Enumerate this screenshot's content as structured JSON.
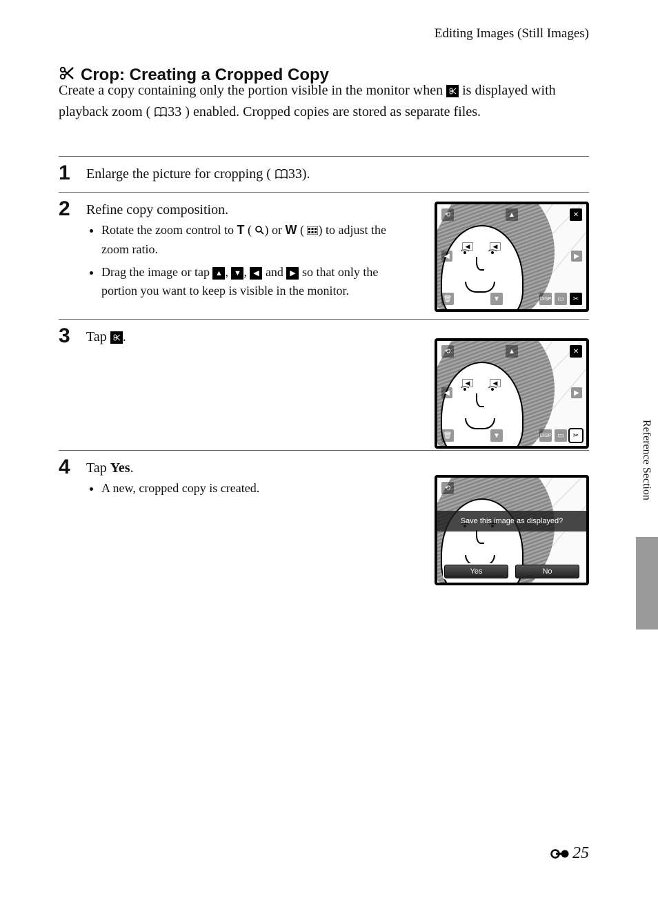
{
  "breadcrumb": "Editing Images (Still Images)",
  "title": "Crop: Creating a Cropped Copy",
  "intro": {
    "part1": "Create a copy containing only the portion visible in the monitor when ",
    "part2": " is displayed with playback zoom (",
    "ref1": "33",
    "part3": ") enabled. Cropped copies are stored as separate files."
  },
  "steps": {
    "s1": {
      "num": "1",
      "line_a": "Enlarge the picture for cropping (",
      "ref": "33",
      "line_b": ")."
    },
    "s2": {
      "num": "2",
      "line": "Refine copy composition.",
      "b1a": "Rotate the zoom control to ",
      "b1_T": "T",
      "b1b": " (",
      "b1c": ") or ",
      "b1_W": "W",
      "b1d": " (",
      "b1e": ") to adjust the zoom ratio.",
      "b2a": "Drag the image or tap ",
      "b2b": ", ",
      "b2c": ", ",
      "b2d": " and ",
      "b2e": " so that only the portion you want to keep is visible in the monitor."
    },
    "s3": {
      "num": "3",
      "line_a": "Tap ",
      "line_b": "."
    },
    "s4": {
      "num": "4",
      "line_a": "Tap ",
      "yes": "Yes",
      "line_b": ".",
      "b1": "A new, cropped copy is created."
    }
  },
  "screens": {
    "dialog_text": "Save this image as displayed?",
    "btn_yes": "Yes",
    "btn_no": "No"
  },
  "sidebar": "Reference Section",
  "page_number": "25"
}
